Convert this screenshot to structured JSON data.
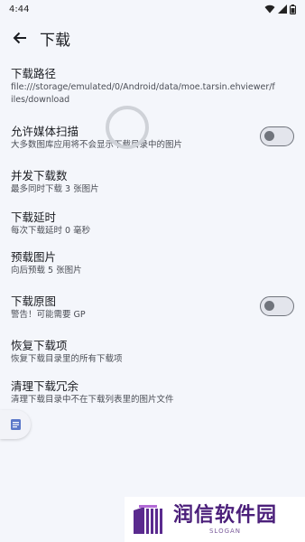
{
  "status_bar": {
    "time": "4:44"
  },
  "app_bar": {
    "title": "下载"
  },
  "settings": [
    {
      "title": "下载路径",
      "subtitle": "file:///storage/emulated/0/Android/data/moe.tarsin.ehviewer/files/download"
    },
    {
      "title": "允许媒体扫描",
      "subtitle": "大多数图库应用将不会显示下载目录中的图片",
      "switch": false
    },
    {
      "title": "并发下载数",
      "subtitle": "最多同时下载 3 张图片"
    },
    {
      "title": "下载延时",
      "subtitle": "每次下载延时 0 毫秒"
    },
    {
      "title": "预载图片",
      "subtitle": "向后预载 5 张图片"
    },
    {
      "title": "下载原图",
      "subtitle": "警告！可能需要 GP",
      "switch": false
    },
    {
      "title": "恢复下载项",
      "subtitle": "恢复下载目录里的所有下载项"
    },
    {
      "title": "清理下载冗余",
      "subtitle": "清理下载目录中不在下载列表里的图片文件"
    }
  ],
  "watermark": {
    "name": "润信软件园",
    "slogan": "SLOGAN"
  },
  "icons": {
    "back": "arrow-left-icon",
    "wifi": "wifi-icon",
    "signal": "signal-icon",
    "battery": "battery-icon",
    "side_tab": "document-icon"
  },
  "colors": {
    "background": "#f4f6fb",
    "switch_off": "#70747c",
    "watermark": "#4b1f7a"
  }
}
